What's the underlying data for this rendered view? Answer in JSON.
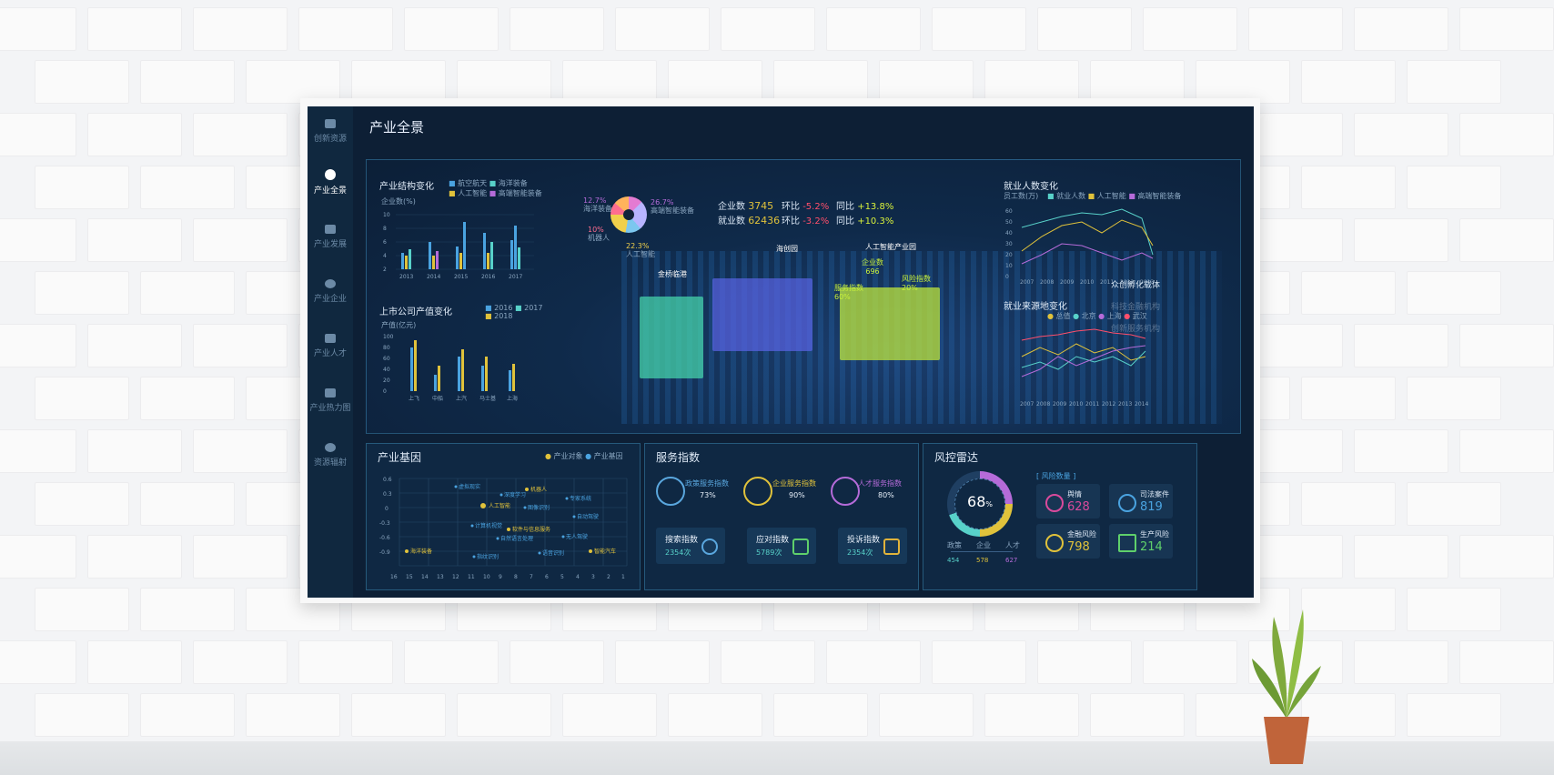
{
  "sidebar": {
    "items": [
      {
        "label": "创新资源"
      },
      {
        "label": "产业全景"
      },
      {
        "label": "产业发展"
      },
      {
        "label": "产业企业"
      },
      {
        "label": "产业人才"
      },
      {
        "label": "产业热力图"
      },
      {
        "label": "资源辐射"
      }
    ]
  },
  "page": {
    "title": "产业全景"
  },
  "hero": {
    "industry_structure": {
      "title": "产业结构变化",
      "legend": [
        "航空航天",
        "海洋装备",
        "人工智能",
        "高端智能装备"
      ],
      "unit": "企业数(%)",
      "y_ticks": [
        "10",
        "8",
        "6",
        "4",
        "2",
        "0"
      ],
      "x_ticks": [
        "2013",
        "2014",
        "2015",
        "2016",
        "2017"
      ]
    },
    "listed_output": {
      "title": "上市公司产值变化",
      "legend": [
        "2016",
        "2017",
        "2018"
      ],
      "unit": "产值(亿元)",
      "y_ticks": [
        "100",
        "80",
        "60",
        "40",
        "20",
        "0"
      ],
      "x_ticks": [
        "上飞",
        "中船",
        "上汽",
        "马士基",
        "上海"
      ]
    },
    "pie": {
      "labels": [
        {
          "pct": "12.7%",
          "name": "海洋装备"
        },
        {
          "pct": "26.7%",
          "name": "高端智能装备"
        },
        {
          "pct": "10%",
          "name": "机器人"
        },
        {
          "pct": "22.3%",
          "name": "人工智能"
        }
      ]
    },
    "stats": {
      "enterprise_label": "企业数",
      "enterprise_value": "3745",
      "enterprise_mom_label": "环比",
      "enterprise_mom_value": "-5.2%",
      "enterprise_yoy_label": "同比",
      "enterprise_yoy_value": "+13.8%",
      "employment_label": "就业数",
      "employment_value": "62436",
      "employment_mom_label": "环比",
      "employment_mom_value": "-3.2%",
      "employment_yoy_label": "同比",
      "employment_yoy_value": "+10.3%"
    },
    "places": {
      "left": "金桥临港",
      "middle": "海创园",
      "right": "人工智能产业园",
      "enterprise_label": "企业数",
      "enterprise_value": "696",
      "service_label": "服务指数",
      "service_value": "60%",
      "risk_label": "风险指数",
      "risk_value": "20%"
    },
    "employment_change": {
      "title": "就业人数变化",
      "legend": [
        "就业人数",
        "人工智能",
        "高端智能装备"
      ],
      "unit": "员工数(万)",
      "y_ticks": [
        "60",
        "50",
        "40",
        "30",
        "20",
        "10",
        "0"
      ],
      "x_ticks": [
        "2007",
        "2008",
        "2009",
        "2010",
        "2011",
        "2012",
        "2013"
      ]
    },
    "employment_source": {
      "title": "就业来源地变化",
      "legend": [
        "总值",
        "北京",
        "上海",
        "武汉"
      ],
      "x_ticks": [
        "2007",
        "2008",
        "2009",
        "2010",
        "2011",
        "2012",
        "2013",
        "2014"
      ]
    },
    "overlay_menu": [
      "众创孵化载体",
      "科技金融机构",
      "创新服务机构"
    ]
  },
  "gene": {
    "title": "产业基因",
    "legend": [
      "产业对象",
      "产业基因"
    ],
    "y_ticks": [
      "0.6",
      "0.3",
      "0",
      "-0.3",
      "-0.6",
      "-0.9"
    ],
    "x_ticks": [
      "16",
      "15",
      "14",
      "13",
      "12",
      "11",
      "10",
      "9",
      "8",
      "7",
      "6",
      "5",
      "4",
      "3",
      "2",
      "1"
    ],
    "points": [
      {
        "label": "机器人",
        "type": "object"
      },
      {
        "label": "人工智能",
        "type": "object"
      },
      {
        "label": "海洋装备",
        "type": "object"
      },
      {
        "label": "智能汽车",
        "type": "object"
      },
      {
        "label": "软件与信息服务",
        "type": "object"
      },
      {
        "label": "虚拟现实",
        "type": "gene"
      },
      {
        "label": "专家系统",
        "type": "gene"
      },
      {
        "label": "深度学习",
        "type": "gene"
      },
      {
        "label": "图像识别",
        "type": "gene"
      },
      {
        "label": "计算机视觉",
        "type": "gene"
      },
      {
        "label": "自动驾驶",
        "type": "gene"
      },
      {
        "label": "自然语言处理",
        "type": "gene"
      },
      {
        "label": "无人驾驶",
        "type": "gene"
      },
      {
        "label": "指纹识别",
        "type": "gene"
      },
      {
        "label": "语音识别",
        "type": "gene"
      }
    ]
  },
  "service": {
    "title": "服务指数",
    "indices": [
      {
        "label": "政策服务指数",
        "value": "73%"
      },
      {
        "label": "企业服务指数",
        "value": "90%"
      },
      {
        "label": "人才服务指数",
        "value": "80%"
      }
    ],
    "cards": [
      {
        "label": "搜索指数",
        "value": "2354次"
      },
      {
        "label": "应对指数",
        "value": "5789次"
      },
      {
        "label": "投诉指数",
        "value": "2354次"
      }
    ]
  },
  "risk": {
    "title": "风控雷达",
    "score": "68",
    "score_unit": "%",
    "sub_labels": [
      "政策",
      "企业",
      "人才"
    ],
    "sub_values": [
      "454",
      "578",
      "627"
    ],
    "data_tag": "风险数量",
    "cards": [
      {
        "label": "舆情",
        "value": "628",
        "color": "#d94a9c"
      },
      {
        "label": "司法案件",
        "value": "819",
        "color": "#4aa3e0"
      },
      {
        "label": "金融风险",
        "value": "798",
        "color": "#e0c23b"
      },
      {
        "label": "生产风险",
        "value": "214",
        "color": "#5fd06b"
      }
    ]
  },
  "colors": {
    "accent_blue": "#4aa3e0",
    "accent_yellow": "#e0c23b",
    "accent_teal": "#58d1c9",
    "accent_pink": "#d94a9c",
    "negative": "#ff4f6b",
    "positive": "#d9f23b"
  }
}
